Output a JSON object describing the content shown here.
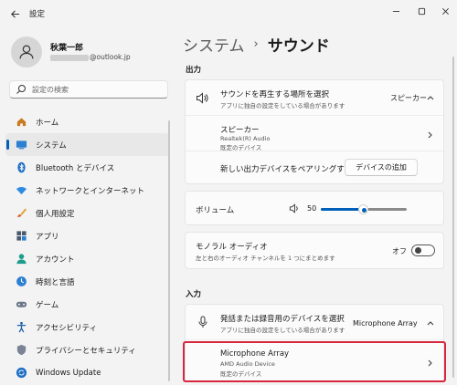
{
  "window": {
    "title": "設定"
  },
  "user": {
    "name": "秋葉一郎",
    "email_visible": "@outlook.jp"
  },
  "search": {
    "placeholder": "設定の検索"
  },
  "nav": [
    {
      "label": "ホーム",
      "icon": "home-icon"
    },
    {
      "label": "システム",
      "icon": "system-icon",
      "active": true
    },
    {
      "label": "Bluetooth とデバイス",
      "icon": "bluetooth-icon"
    },
    {
      "label": "ネットワークとインターネット",
      "icon": "wifi-icon"
    },
    {
      "label": "個人用設定",
      "icon": "brush-icon"
    },
    {
      "label": "アプリ",
      "icon": "apps-icon"
    },
    {
      "label": "アカウント",
      "icon": "account-icon"
    },
    {
      "label": "時刻と言語",
      "icon": "time-language-icon"
    },
    {
      "label": "ゲーム",
      "icon": "gamepad-icon"
    },
    {
      "label": "アクセシビリティ",
      "icon": "accessibility-icon"
    },
    {
      "label": "プライバシーとセキュリティ",
      "icon": "shield-icon"
    },
    {
      "label": "Windows Update",
      "icon": "update-icon"
    }
  ],
  "breadcrumb": {
    "parent": "システム",
    "separator": "›",
    "current": "サウンド"
  },
  "output": {
    "section_label": "出力",
    "choose": {
      "title": "サウンドを再生する場所を選択",
      "subtitle": "アプリに独自の設定をしている場合があります",
      "value": "スピーカー"
    },
    "device": {
      "name": "スピーカー",
      "driver": "Realtek(R) Audio",
      "status": "既定のデバイス"
    },
    "pair": {
      "label": "新しい出力デバイスをペアリングする",
      "button": "デバイスの追加"
    },
    "volume": {
      "label": "ボリューム",
      "value": "50",
      "level": 0.5
    },
    "mono": {
      "title": "モノラル オーディオ",
      "subtitle": "左と右のオーディオ チャンネルを 1 つにまとめます",
      "state": "オフ"
    }
  },
  "input": {
    "section_label": "入力",
    "choose": {
      "title": "発話または録音用のデバイスを選択",
      "subtitle": "アプリに独自の設定をしている場合があります",
      "value": "Microphone Array"
    },
    "device": {
      "name": "Microphone Array",
      "driver": "AMD Audio Device",
      "status": "既定のデバイス"
    }
  },
  "colors": {
    "accent": "#005fb8",
    "highlight": "#d7263d"
  }
}
